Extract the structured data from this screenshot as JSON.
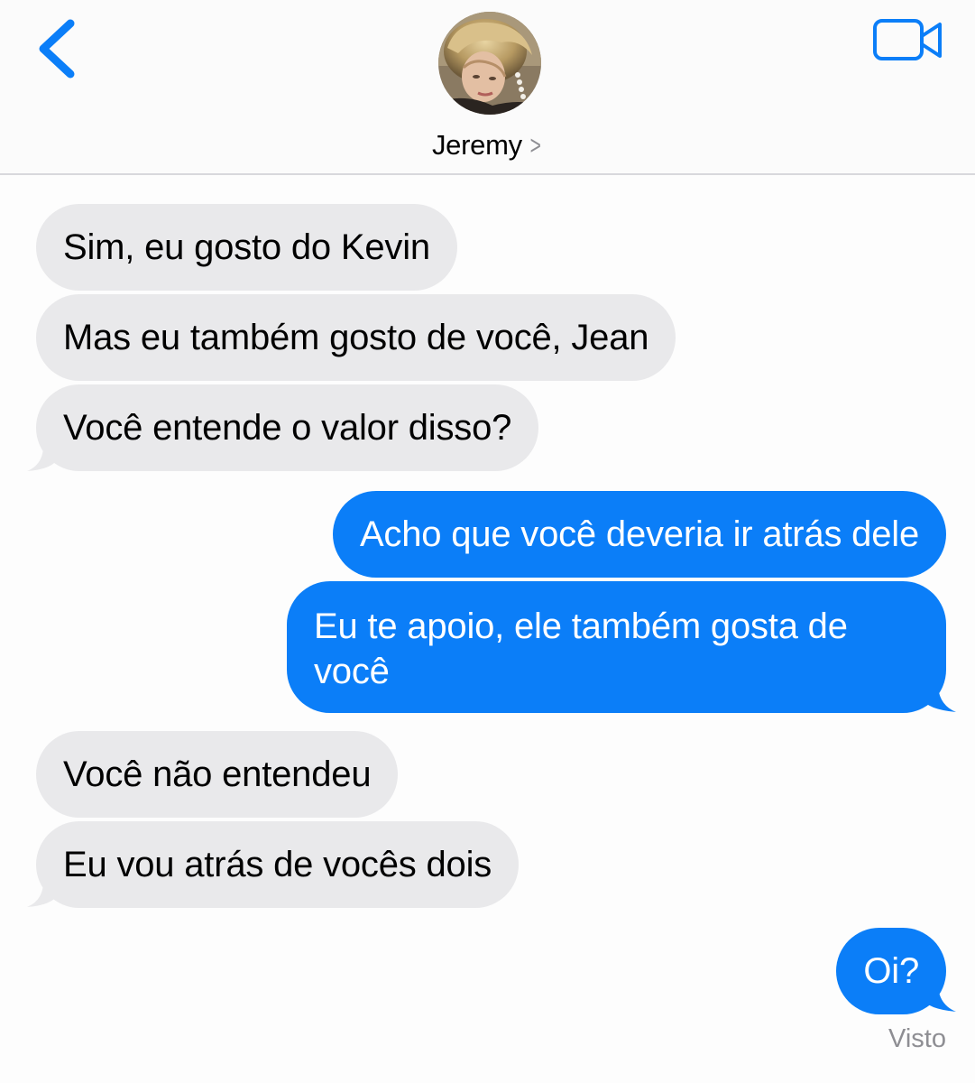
{
  "header": {
    "contact_name": "Jeremy",
    "chevron": ">",
    "back_icon": "chevron-left-icon",
    "video_icon": "video-camera-icon",
    "accent": "#0b7ef8"
  },
  "messages": [
    {
      "direction": "incoming",
      "text": "Sim, eu gosto do Kevin"
    },
    {
      "direction": "incoming",
      "text": "Mas eu também gosto de você, Jean"
    },
    {
      "direction": "incoming",
      "text": "Você entende o valor disso?"
    },
    {
      "direction": "outgoing",
      "text": "Acho que você deveria ir atrás dele"
    },
    {
      "direction": "outgoing",
      "text": "Eu te apoio, ele também gosta de você"
    },
    {
      "direction": "incoming",
      "text": "Você não entendeu"
    },
    {
      "direction": "incoming",
      "text": "Eu vou atrás de vocês dois"
    },
    {
      "direction": "outgoing",
      "text": "Oi?"
    }
  ],
  "status": "Visto",
  "colors": {
    "incoming_bubble": "#e9e9eb",
    "outgoing_bubble": "#0b7ef8",
    "status_text": "#8e8e93"
  }
}
